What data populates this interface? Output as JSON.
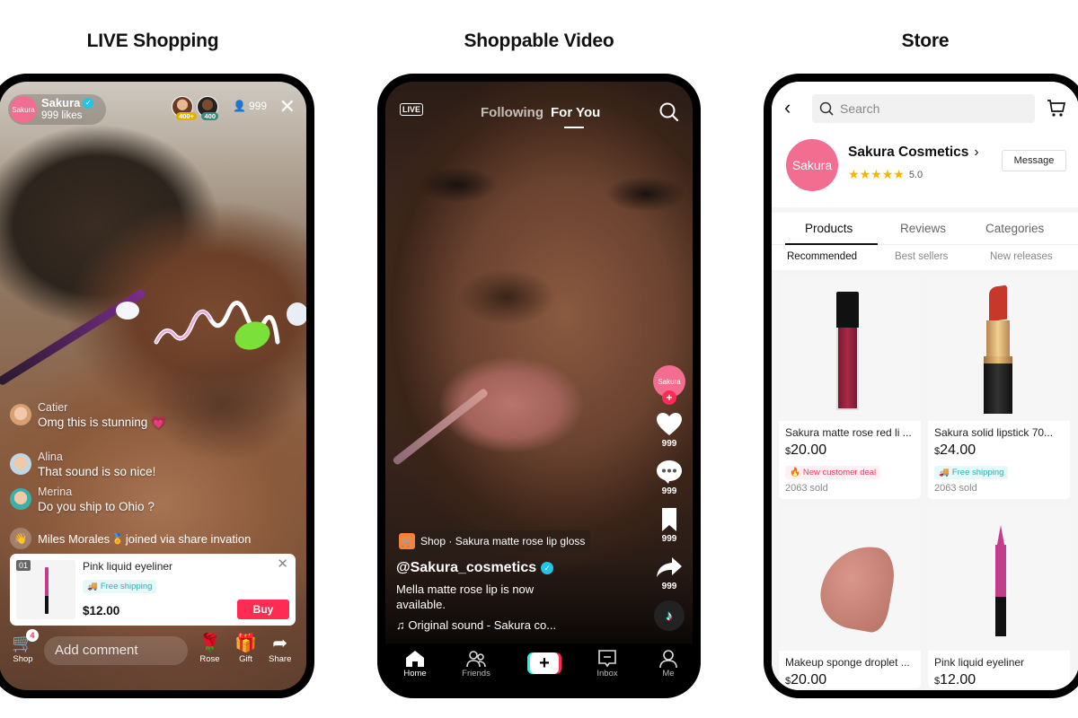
{
  "sections": {
    "live": "LIVE Shopping",
    "video": "Shoppable Video",
    "store": "Store"
  },
  "live": {
    "host": {
      "avatar": "Sakura",
      "name": "Sakura",
      "likes": "999 likes",
      "verified": true
    },
    "top_viewers": [
      {
        "badge": "400+",
        "badge_color": "#e0b000"
      },
      {
        "badge": "400",
        "badge_color": "#3c8a7a"
      }
    ],
    "viewer_count": "999",
    "comments": [
      {
        "name": "Catier",
        "text": "Omg this is stunning 💗"
      },
      {
        "name": "Alina",
        "text": "That sound is so nice!"
      },
      {
        "name": "Merina",
        "text": "Do you ship to Ohio ?"
      }
    ],
    "join_notice": {
      "name": "Miles Morales",
      "badge": "🏅",
      "text": "joined via share invation"
    },
    "product_card": {
      "index": "01",
      "title": "Pink liquid eyeliner",
      "shipping": "Free shipping",
      "price": "$12.00",
      "buy_label": "Buy"
    },
    "bottom_bar": {
      "shop_label": "Shop",
      "shop_badge": "4",
      "comment_placeholder": "Add comment",
      "rose_label": "Rose",
      "gift_label": "Gift",
      "share_label": "Share"
    }
  },
  "video": {
    "live_icon_label": "LIVE",
    "tabs": [
      {
        "label": "Following",
        "active": false
      },
      {
        "label": "For You",
        "active": true
      }
    ],
    "creator_avatar": "Sakura",
    "actions": [
      {
        "name": "like",
        "count": "999"
      },
      {
        "name": "comment",
        "count": "999"
      },
      {
        "name": "bookmark",
        "count": "999"
      },
      {
        "name": "share",
        "count": "999"
      }
    ],
    "shop_tag": "Shop · Sakura matte rose lip gloss",
    "author": "@Sakura_cosmetics",
    "description": "Mella matte rose lip is now available.",
    "sound": "♫ Original sound - Sakura co...",
    "nav": [
      {
        "label": "Home",
        "active": true
      },
      {
        "label": "Friends",
        "active": false
      },
      {
        "label": "Inbox",
        "active": false
      },
      {
        "label": "Me",
        "active": false
      }
    ],
    "nav_plus": "+"
  },
  "store": {
    "search_placeholder": "Search",
    "shop_logo": "Sakura",
    "shop_name": "Sakura Cosmetics",
    "rating": "5.0",
    "stars": 5,
    "message_label": "Message",
    "tabs": [
      {
        "label": "Products",
        "active": true
      },
      {
        "label": "Reviews",
        "active": false
      },
      {
        "label": "Categories",
        "active": false
      }
    ],
    "subtabs": [
      {
        "label": "Recommended",
        "active": true
      },
      {
        "label": "Best sellers",
        "active": false
      },
      {
        "label": "New releases",
        "active": false
      }
    ],
    "products": [
      {
        "name": "Sakura matte rose red li ...",
        "currency": "$",
        "price": "20.00",
        "badge": "New customer deal",
        "badge_type": "deal",
        "sold": "2063 sold"
      },
      {
        "name": "Sakura solid lipstick 70...",
        "currency": "$",
        "price": "24.00",
        "badge": "Free shipping",
        "badge_type": "shipping",
        "sold": "2063 sold"
      },
      {
        "name": "Makeup sponge droplet ...",
        "currency": "$",
        "price": "20.00"
      },
      {
        "name": "Pink liquid eyeliner",
        "currency": "$",
        "price": "12.00"
      }
    ]
  },
  "colors": {
    "brand_pink": "#f26d8f",
    "tiktok_red": "#fe2c55",
    "tiktok_cyan": "#25f4ee",
    "star_yellow": "#f5b400",
    "shipping_teal": "#27b1b6"
  }
}
